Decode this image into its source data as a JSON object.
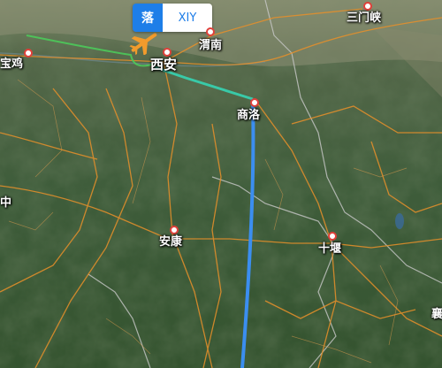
{
  "badge": {
    "code": "落",
    "airport": "XIY"
  },
  "cities": {
    "baoji": "宝鸡",
    "xian": "西安",
    "weinan": "渭南",
    "sanmenxia": "三门峡",
    "shangluo": "商洛",
    "ankang": "安康",
    "shiyan": "十堰",
    "partial_left": "中",
    "partial_right": "襄"
  },
  "colors": {
    "flight_path": "#3b8ef0",
    "approach_path": "#39c9a8",
    "road": "#e8902a",
    "boundary": "#c9c9c9",
    "badge_blue": "#1e7ee8",
    "plane": "#f29b2c"
  },
  "icons": {
    "aircraft": "airplane-icon",
    "city_marker": "city-dot-icon"
  }
}
